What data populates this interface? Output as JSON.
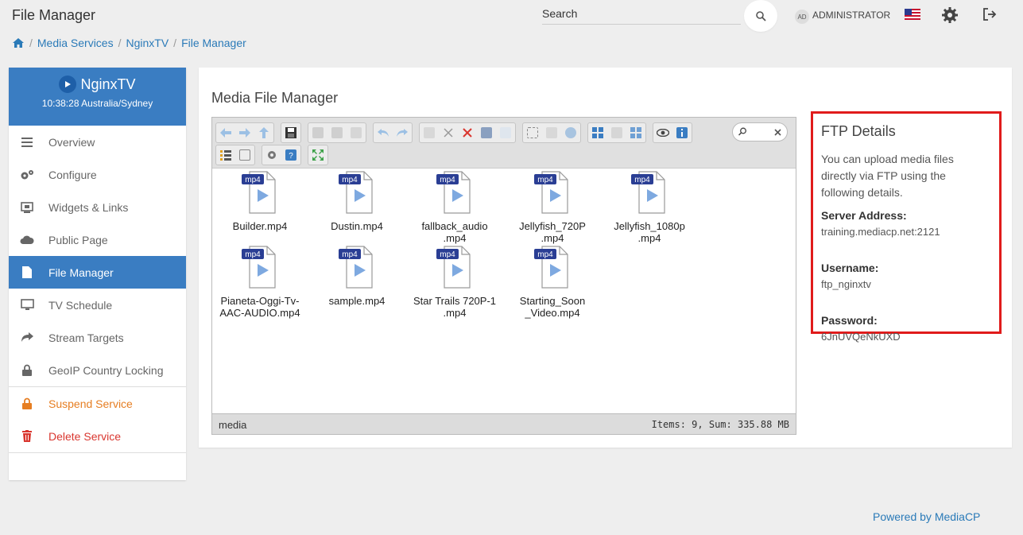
{
  "header": {
    "title": "File Manager",
    "search_placeholder": "Search",
    "user_initials": "AD",
    "user_name": "ADMINISTRATOR"
  },
  "breadcrumb": [
    "Media Services",
    "NginxTV",
    "File Manager"
  ],
  "sidebar": {
    "service_name": "NginxTV",
    "time": "10:38:28 Australia/Sydney",
    "items": [
      {
        "label": "Overview",
        "icon": "bars-icon"
      },
      {
        "label": "Configure",
        "icon": "cogs-icon"
      },
      {
        "label": "Widgets & Links",
        "icon": "widget-icon"
      },
      {
        "label": "Public Page",
        "icon": "cloud-icon"
      },
      {
        "label": "File Manager",
        "icon": "file-icon"
      },
      {
        "label": "TV Schedule",
        "icon": "monitor-icon"
      },
      {
        "label": "Stream Targets",
        "icon": "share-icon"
      },
      {
        "label": "GeoIP Country Locking",
        "icon": "lock-icon"
      },
      {
        "label": "Suspend Service",
        "icon": "lock-icon"
      },
      {
        "label": "Delete Service",
        "icon": "trash-icon"
      }
    ]
  },
  "main": {
    "title": "Media File Manager",
    "file_badge": "mp4",
    "files": [
      [
        "Builder.mp4"
      ],
      [
        "Dustin.mp4"
      ],
      [
        "fallback_audio",
        ".mp4"
      ],
      [
        "Jellyfish_720P",
        ".mp4"
      ],
      [
        "Jellyfish_1080p",
        ".mp4"
      ],
      [
        "Pianeta-Oggi-Tv-",
        "AAC-AUDIO.mp4"
      ],
      [
        "sample.mp4"
      ],
      [
        "Star Trails 720P-1",
        ".mp4"
      ],
      [
        "Starting_Soon",
        "_Video.mp4"
      ]
    ],
    "status_path": "media",
    "status_summary": "Items: 9, Sum: 335.88 MB"
  },
  "ftp": {
    "title": "FTP Details",
    "description": "You can upload media files directly via FTP using the following details.",
    "server_label": "Server Address:",
    "server_value": "training.mediacp.net:2121",
    "username_label": "Username:",
    "username_value": "ftp_nginxtv",
    "password_label": "Password:",
    "password_value": "6JnUVQeNkUXD"
  },
  "footer": {
    "powered": "Powered by MediaCP"
  },
  "colors": {
    "primary": "#3a7dc2",
    "link": "#2a7ab8",
    "suspend": "#e67e22",
    "delete": "#d9362f",
    "highlight_border": "#e01b1b"
  }
}
